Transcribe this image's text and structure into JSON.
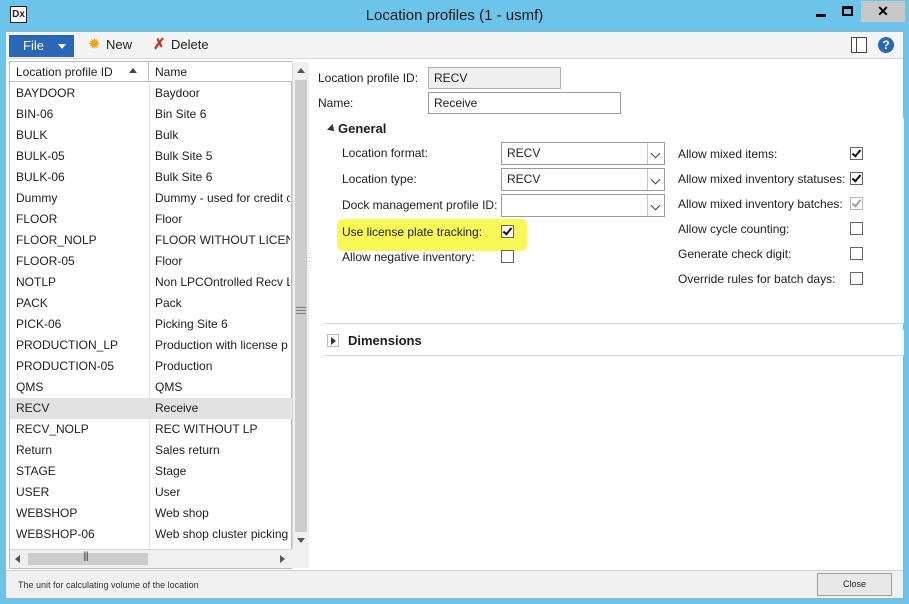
{
  "window": {
    "title": "Location profiles (1 - usmf)",
    "icon": "dynamics-ax-icon"
  },
  "ribbon": {
    "file_label": "File",
    "new_label": "New",
    "delete_label": "Delete"
  },
  "grid": {
    "columns": [
      "Location profile ID",
      "Name"
    ],
    "rows": [
      {
        "id": "BAYDOOR",
        "name": "Baydoor"
      },
      {
        "id": "BIN-06",
        "name": "Bin Site 6"
      },
      {
        "id": "BULK",
        "name": "Bulk"
      },
      {
        "id": "BULK-05",
        "name": "Bulk Site 5"
      },
      {
        "id": "BULK-06",
        "name": "Bulk Site 6"
      },
      {
        "id": "Dummy",
        "name": "Dummy - used for credit c"
      },
      {
        "id": "FLOOR",
        "name": "Floor"
      },
      {
        "id": "FLOOR_NOLP",
        "name": "FLOOR WITHOUT LICENS"
      },
      {
        "id": "FLOOR-05",
        "name": "Floor"
      },
      {
        "id": "NOTLP",
        "name": "Non LPCOntrolled Recv L"
      },
      {
        "id": "PACK",
        "name": "Pack"
      },
      {
        "id": "PICK-06",
        "name": "Picking Site 6"
      },
      {
        "id": "PRODUCTION_LP",
        "name": "Production with license p"
      },
      {
        "id": "PRODUCTION-05",
        "name": "Production"
      },
      {
        "id": "QMS",
        "name": "QMS"
      },
      {
        "id": "RECV",
        "name": "Receive"
      },
      {
        "id": "RECV_NOLP",
        "name": "REC WITHOUT LP"
      },
      {
        "id": "Return",
        "name": "Sales return"
      },
      {
        "id": "STAGE",
        "name": "Stage"
      },
      {
        "id": "USER",
        "name": "User"
      },
      {
        "id": "WEBSHOP",
        "name": "Web shop"
      },
      {
        "id": "WEBSHOP-06",
        "name": "Web shop cluster picking"
      }
    ],
    "selected_id": "RECV"
  },
  "header_fields": {
    "profile_id_label": "Location profile ID:",
    "profile_id_value": "RECV",
    "name_label": "Name:",
    "name_value": "Receive"
  },
  "general": {
    "title": "General",
    "location_format_label": "Location format:",
    "location_format_value": "RECV",
    "location_type_label": "Location type:",
    "location_type_value": "RECV",
    "dock_label": "Dock management profile ID:",
    "dock_value": "",
    "lp_tracking_label": "Use license plate tracking:",
    "lp_tracking_checked": true,
    "neg_inventory_label": "Allow negative inventory:",
    "neg_inventory_checked": false,
    "mixed_items_label": "Allow mixed items:",
    "mixed_items_checked": true,
    "mixed_status_label": "Allow mixed  inventory statuses:",
    "mixed_status_checked": true,
    "mixed_batches_label": "Allow mixed inventory batches:",
    "mixed_batches_checked": true,
    "cycle_counting_label": "Allow cycle counting:",
    "cycle_counting_checked": false,
    "check_digit_label": "Generate check digit:",
    "check_digit_checked": false,
    "override_batch_label": "Override rules for batch days:",
    "override_batch_checked": false
  },
  "dimensions": {
    "title": "Dimensions"
  },
  "status": {
    "text": "The unit for calculating volume of the location",
    "close_label": "Close"
  },
  "colors": {
    "titlebar": "#6cc4ea",
    "file_button": "#2a67b8",
    "highlight": "#f7f73a"
  }
}
